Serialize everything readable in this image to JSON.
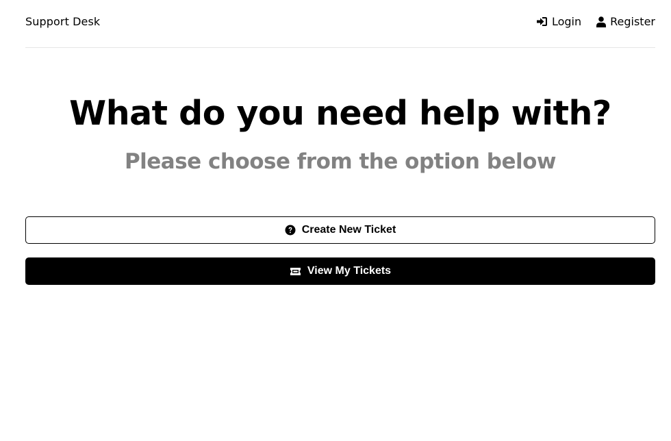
{
  "header": {
    "logo": "Support Desk",
    "nav": {
      "login_label": "Login",
      "login_icon": "sign-in-icon",
      "register_label": "Register",
      "register_icon": "user-icon"
    }
  },
  "main": {
    "title": "What do you need help with?",
    "subtitle": "Please choose from the option below",
    "create_button": {
      "label": "Create New Ticket",
      "icon": "question-circle-icon"
    },
    "view_button": {
      "label": "View My Tickets",
      "icon": "ticket-icon"
    }
  },
  "colors": {
    "subtitle": "#828282",
    "primary_button_bg": "#000000",
    "border": "#e6e6e6"
  }
}
